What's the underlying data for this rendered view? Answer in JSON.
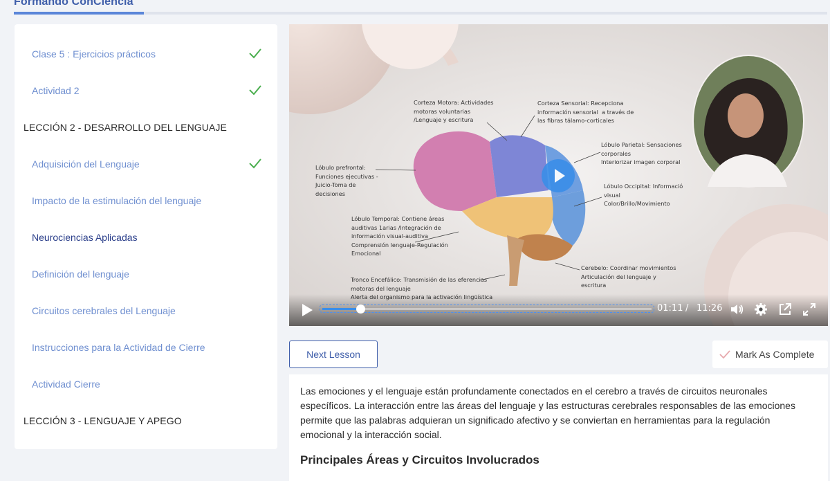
{
  "header": {
    "brand": "Formando ConCiencia",
    "progress": 0.16
  },
  "sidebar": {
    "items": [
      {
        "label": "Clase 5 : Ejercicios prácticos",
        "type": "lesson",
        "completed": true
      },
      {
        "label": "Actividad 2",
        "type": "lesson",
        "completed": true
      },
      {
        "label": "LECCIÓN 2 - DESARROLLO DEL LENGUAJE",
        "type": "section"
      },
      {
        "label": "Adquisición del Lenguaje",
        "type": "lesson",
        "completed": true
      },
      {
        "label": "Impacto de la estimulación del lenguaje",
        "type": "lesson",
        "completed": false
      },
      {
        "label": "Neurociencias Aplicadas",
        "type": "lesson",
        "completed": false,
        "active": true
      },
      {
        "label": "Definición del lenguaje",
        "type": "lesson",
        "completed": false
      },
      {
        "label": "Circuitos cerebrales del Lenguaje",
        "type": "lesson",
        "completed": false
      },
      {
        "label": "Instrucciones para la Actividad de Cierre",
        "type": "lesson",
        "completed": false
      },
      {
        "label": "Actividad Cierre",
        "type": "lesson",
        "completed": false
      },
      {
        "label": "LECCIÓN 3 - LENGUAJE Y APEGO",
        "type": "section"
      }
    ]
  },
  "video": {
    "labels": {
      "motora": "Corteza Motora: Actividades\nmotoras voluntarias\n/Lenguaje y escritura",
      "sensorial": "Corteza Sensorial: Recepciona\ninformación sensorial  a través de\nlas fibras tálamo-corticales",
      "parietal": "Lóbulo Parietal: Sensaciones\ncorporales\nInteriorizar imagen corporal",
      "prefrontal": "Lóbulo prefrontal:\nFunciones ejecutivas -\nJuicio-Toma de\ndecisiones",
      "occipital": "Lóbulo Occipital: Informació\nvisual\nColor/Brillo/Movimiento",
      "temporal": "Lóbulo Temporal: Contiene áreas\nauditivas 1arias /Integración de\ninformación visual-auditiva\nComprensión lenguaje-Regulación\nEmocional",
      "cerebelo": "Cerebelo: Coordinar movimientos\nArticulación del lenguaje y\nescritura",
      "tronco": "Tronco Encefálico: Transmisión de las eferencias\nmotoras del lenguaje\nAlerta del organismo para la activación lingüística"
    },
    "current_time": "01:11",
    "separator": "/",
    "duration": "11:26",
    "played_fraction": 0.115
  },
  "actions": {
    "next_label": "Next Lesson",
    "complete_label": "Mark As Complete"
  },
  "content": {
    "paragraph": "Las emociones y el lenguaje están profundamente conectados en el cerebro a través de circuitos neuronales específicos. La interacción entre las áreas del lenguaje y las estructuras cerebrales responsables de las emociones permite que las palabras adquieran un significado afectivo y se conviertan en herramientas para la regulación emocional y la interacción social.",
    "heading": "Principales Áreas y Circuitos Involucrados"
  },
  "colors": {
    "accent": "#3f5eaa",
    "link": "#6f8fd0",
    "check": "#4caf50",
    "player": "#3b8ee8"
  }
}
